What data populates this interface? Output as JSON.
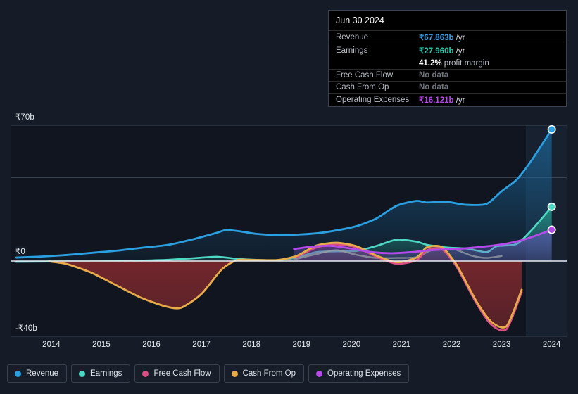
{
  "axes": {
    "y_labels": {
      "top": "₹70b",
      "zero": "₹0",
      "bottom": "-₹40b"
    },
    "x_labels": [
      "2014",
      "2015",
      "2016",
      "2017",
      "2018",
      "2019",
      "2020",
      "2021",
      "2022",
      "2023",
      "2024"
    ]
  },
  "tooltip": {
    "title": "Jun 30 2024",
    "rows": [
      {
        "key": "Revenue",
        "amount": "₹67.863b",
        "unit": " /yr",
        "color": "#3a9ee0",
        "nodata": false
      },
      {
        "key": "Earnings",
        "amount": "₹27.960b",
        "unit": " /yr",
        "color": "#2ec4a8",
        "nodata": false
      },
      {
        "key": "",
        "amount": "41.2%",
        "unit": " profit margin",
        "color": "#ffffff",
        "nodata": false
      },
      {
        "key": "Free Cash Flow",
        "amount": "No data",
        "unit": "",
        "color": "#6d727b",
        "nodata": true
      },
      {
        "key": "Cash From Op",
        "amount": "No data",
        "unit": "",
        "color": "#6d727b",
        "nodata": true
      },
      {
        "key": "Operating Expenses",
        "amount": "₹16.121b",
        "unit": " /yr",
        "color": "#b44ae8",
        "nodata": false
      }
    ]
  },
  "legend": {
    "items": [
      {
        "label": "Revenue",
        "color": "#2b9fe0"
      },
      {
        "label": "Earnings",
        "color": "#4fd9c4"
      },
      {
        "label": "Free Cash Flow",
        "color": "#d94f86"
      },
      {
        "label": "Cash From Op",
        "color": "#e8ab4a"
      },
      {
        "label": "Operating Expenses",
        "color": "#b44ae8"
      }
    ]
  },
  "chart_data": {
    "type": "area",
    "title": "",
    "xlabel": "",
    "ylabel": "",
    "currency": "INR",
    "unit": "billions",
    "xlim": [
      2013.7,
      2024.8
    ],
    "ylim": [
      -40,
      70
    ],
    "grid": true,
    "legend_position": "bottom",
    "highlight_band": {
      "from": 2024.0,
      "to": 2024.8
    },
    "series": [
      {
        "name": "Revenue",
        "color": "#2b9fe0",
        "x": [
          2013.8,
          2014.3,
          2014.8,
          2015.3,
          2015.8,
          2016.3,
          2016.8,
          2017.3,
          2017.8,
          2018.0,
          2018.3,
          2018.6,
          2019.0,
          2019.4,
          2019.8,
          2020.2,
          2020.6,
          2021.0,
          2021.4,
          2021.8,
          2022.0,
          2022.4,
          2022.8,
          2023.2,
          2023.5,
          2023.8,
          2024.1,
          2024.5
        ],
        "values": [
          1.8,
          2.3,
          3.1,
          4.2,
          5.3,
          6.8,
          8.2,
          11.0,
          14.5,
          16.0,
          15.2,
          14.0,
          13.4,
          13.6,
          14.3,
          15.8,
          18.0,
          22.0,
          28.5,
          31.0,
          30.2,
          30.5,
          29.0,
          29.5,
          36.0,
          42.0,
          52.0,
          67.863
        ]
      },
      {
        "name": "Earnings",
        "color": "#4fd9c4",
        "x": [
          2013.8,
          2014.3,
          2014.8,
          2015.3,
          2015.8,
          2016.3,
          2016.8,
          2017.3,
          2017.8,
          2018.2,
          2018.6,
          2019.0,
          2019.4,
          2019.8,
          2020.2,
          2020.6,
          2021.0,
          2021.4,
          2021.8,
          2022.0,
          2022.4,
          2022.8,
          2023.2,
          2023.4,
          2023.8,
          2024.1,
          2024.5
        ],
        "values": [
          -0.4,
          -0.3,
          -0.2,
          -0.2,
          -0.1,
          0.2,
          0.6,
          1.4,
          2.2,
          1.2,
          0.6,
          0.4,
          1.8,
          4.6,
          5.0,
          5.2,
          7.8,
          11.0,
          10.0,
          8.4,
          7.0,
          6.4,
          4.6,
          7.6,
          8.8,
          16.0,
          27.96
        ]
      },
      {
        "name": "Free Cash Flow",
        "color": "#d94f86",
        "x": [
          2019.4,
          2019.8,
          2020.2,
          2020.6,
          2021.0,
          2021.4,
          2021.8,
          2022.0,
          2022.3,
          2022.6,
          2023.0,
          2023.3,
          2023.6,
          2023.9
        ],
        "values": [
          2.0,
          7.0,
          8.6,
          7.0,
          2.2,
          -1.4,
          0.4,
          5.5,
          6.2,
          -3.0,
          -22.0,
          -33.0,
          -35.0,
          -16.0
        ]
      },
      {
        "name": "Cash From Op",
        "color": "#e8ab4a",
        "x": [
          2014.45,
          2014.8,
          2015.3,
          2015.8,
          2016.3,
          2016.8,
          2017.1,
          2017.5,
          2017.9,
          2018.2,
          2018.5,
          2019.0,
          2019.4,
          2019.8,
          2020.2,
          2020.6,
          2021.0,
          2021.4,
          2021.8,
          2022.0,
          2022.3,
          2022.6,
          2023.0,
          2023.3,
          2023.6,
          2023.9
        ],
        "values": [
          -0.2,
          -1.5,
          -6.0,
          -12.5,
          -19.0,
          -23.5,
          -24.0,
          -17.0,
          -4.5,
          0.4,
          0.6,
          0.5,
          2.6,
          8.0,
          9.4,
          7.6,
          2.8,
          -0.6,
          1.8,
          7.0,
          7.2,
          -2.0,
          -21.0,
          -31.5,
          -33.5,
          -14.8
        ]
      },
      {
        "name": "Operating Expenses",
        "color": "#b44ae8",
        "x": [
          2019.35,
          2019.7,
          2020.1,
          2020.5,
          2020.9,
          2021.3,
          2021.7,
          2022.0,
          2022.4,
          2022.8,
          2023.2,
          2023.6,
          2024.0,
          2024.5
        ],
        "values": [
          6.2,
          7.4,
          7.8,
          6.4,
          4.6,
          4.0,
          4.6,
          5.4,
          6.0,
          6.6,
          7.6,
          9.0,
          11.5,
          16.121
        ]
      },
      {
        "name": "Free Cash Flow (muted)",
        "color": "#9aa0a8",
        "x": [
          2019.35,
          2019.8,
          2020.2,
          2020.6,
          2021.0,
          2021.4,
          2021.8,
          2022.1,
          2022.5,
          2022.9,
          2023.2,
          2023.5
        ],
        "values": [
          0.8,
          3.6,
          5.6,
          3.2,
          1.6,
          1.6,
          2.0,
          5.6,
          6.4,
          2.8,
          1.6,
          2.6
        ]
      }
    ]
  }
}
